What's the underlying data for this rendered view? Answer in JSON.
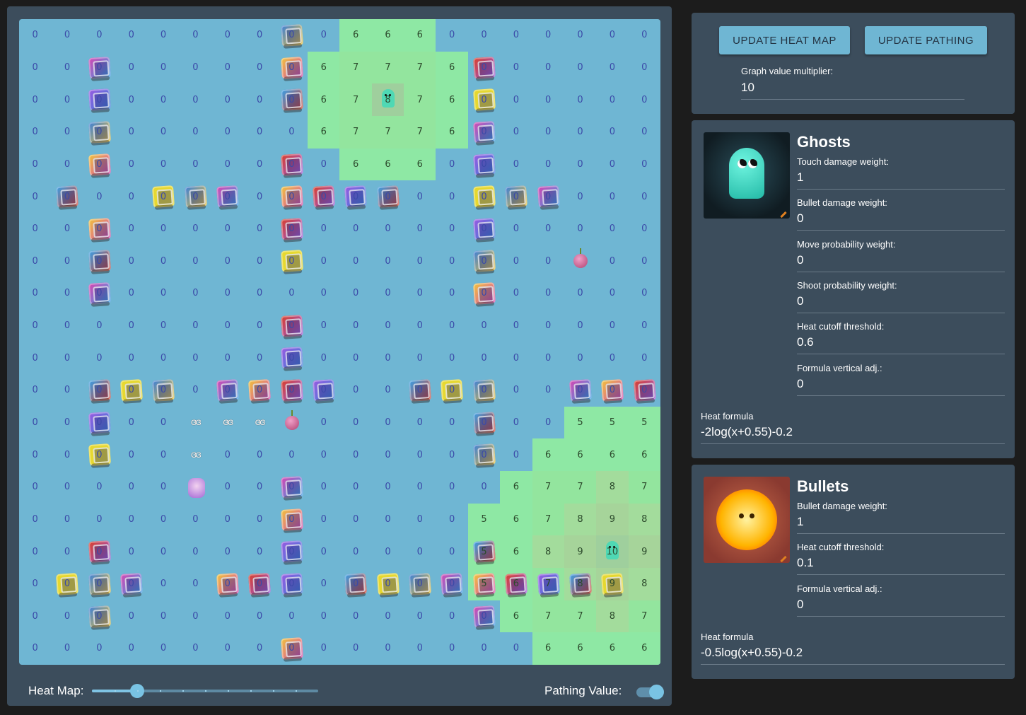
{
  "grid": {
    "rows": [
      [
        "0",
        "0",
        "0",
        "0",
        "0",
        "0",
        "0",
        "0",
        "0",
        "0",
        "6",
        "6",
        "6",
        "0",
        "0",
        "0",
        "0",
        "0",
        "0",
        "0"
      ],
      [
        "0",
        "0",
        "0",
        "0",
        "0",
        "0",
        "0",
        "0",
        "0",
        "6",
        "7",
        "7",
        "7",
        "6",
        "0",
        "0",
        "0",
        "0",
        "0",
        "0"
      ],
      [
        "0",
        "0",
        "0",
        "0",
        "0",
        "0",
        "0",
        "0",
        "0",
        "6",
        "7",
        "8",
        "7",
        "6",
        "0",
        "0",
        "0",
        "0",
        "0",
        "0"
      ],
      [
        "0",
        "0",
        "0",
        "0",
        "0",
        "0",
        "0",
        "0",
        "0",
        "6",
        "7",
        "7",
        "7",
        "6",
        "0",
        "0",
        "0",
        "0",
        "0",
        "0"
      ],
      [
        "0",
        "0",
        "0",
        "0",
        "0",
        "0",
        "0",
        "0",
        "0",
        "0",
        "6",
        "6",
        "6",
        "0",
        "0",
        "0",
        "0",
        "0",
        "0",
        "0"
      ],
      [
        "0",
        "0",
        "0",
        "0",
        "0",
        "0",
        "0",
        "0",
        "0",
        "0",
        "0",
        "0",
        "0",
        "0",
        "0",
        "0",
        "0",
        "0",
        "0",
        "0"
      ],
      [
        "0",
        "0",
        "0",
        "0",
        "0",
        "0",
        "0",
        "0",
        "0",
        "0",
        "0",
        "0",
        "0",
        "0",
        "0",
        "0",
        "0",
        "0",
        "0",
        "0"
      ],
      [
        "0",
        "0",
        "0",
        "0",
        "0",
        "0",
        "0",
        "0",
        "0",
        "0",
        "0",
        "0",
        "0",
        "0",
        "0",
        "0",
        "0",
        "0",
        "0",
        "0"
      ],
      [
        "0",
        "0",
        "0",
        "0",
        "0",
        "0",
        "0",
        "0",
        "0",
        "0",
        "0",
        "0",
        "0",
        "0",
        "0",
        "0",
        "0",
        "0",
        "0",
        "0"
      ],
      [
        "0",
        "0",
        "0",
        "0",
        "0",
        "0",
        "0",
        "0",
        "0",
        "0",
        "0",
        "0",
        "0",
        "0",
        "0",
        "0",
        "0",
        "0",
        "0",
        "0"
      ],
      [
        "0",
        "0",
        "0",
        "0",
        "0",
        "0",
        "0",
        "0",
        "0",
        "0",
        "0",
        "0",
        "0",
        "0",
        "0",
        "0",
        "0",
        "0",
        "0",
        "0"
      ],
      [
        "0",
        "0",
        "0",
        "0",
        "0",
        "0",
        "0",
        "0",
        "0",
        "0",
        "0",
        "0",
        "0",
        "0",
        "0",
        "0",
        "0",
        "0",
        "0",
        "0"
      ],
      [
        "0",
        "0",
        "0",
        "0",
        "0",
        "0",
        "0",
        "0",
        "0",
        "0",
        "0",
        "0",
        "0",
        "0",
        "0",
        "0",
        "0",
        "5",
        "5",
        "5"
      ],
      [
        "0",
        "0",
        "0",
        "0",
        "0",
        "0",
        "0",
        "0",
        "0",
        "0",
        "0",
        "0",
        "0",
        "0",
        "0",
        "0",
        "6",
        "6",
        "6",
        "6"
      ],
      [
        "0",
        "0",
        "0",
        "0",
        "0",
        "0",
        "0",
        "0",
        "0",
        "0",
        "0",
        "0",
        "0",
        "0",
        "0",
        "6",
        "7",
        "7",
        "8",
        "7"
      ],
      [
        "0",
        "0",
        "0",
        "0",
        "0",
        "0",
        "0",
        "0",
        "0",
        "0",
        "0",
        "0",
        "0",
        "0",
        "5",
        "6",
        "7",
        "8",
        "9",
        "8"
      ],
      [
        "0",
        "0",
        "0",
        "0",
        "0",
        "0",
        "0",
        "0",
        "0",
        "0",
        "0",
        "0",
        "0",
        "0",
        "5",
        "6",
        "8",
        "9",
        "10",
        "9"
      ],
      [
        "0",
        "0",
        "0",
        "0",
        "0",
        "0",
        "0",
        "0",
        "0",
        "0",
        "0",
        "0",
        "0",
        "0",
        "5",
        "6",
        "7",
        "8",
        "9",
        "8"
      ],
      [
        "0",
        "0",
        "0",
        "0",
        "0",
        "0",
        "0",
        "0",
        "0",
        "0",
        "0",
        "0",
        "0",
        "0",
        "0",
        "6",
        "7",
        "7",
        "8",
        "7"
      ],
      [
        "0",
        "0",
        "0",
        "0",
        "0",
        "0",
        "0",
        "0",
        "0",
        "0",
        "0",
        "0",
        "0",
        "0",
        "0",
        "0",
        "6",
        "6",
        "6",
        "6"
      ]
    ],
    "walls": [
      [
        0,
        8
      ],
      [
        1,
        2
      ],
      [
        1,
        8
      ],
      [
        1,
        14
      ],
      [
        2,
        2
      ],
      [
        2,
        8
      ],
      [
        2,
        14
      ],
      [
        3,
        2
      ],
      [
        3,
        14
      ],
      [
        4,
        2
      ],
      [
        4,
        8
      ],
      [
        4,
        14
      ],
      [
        5,
        1
      ],
      [
        5,
        4
      ],
      [
        5,
        5
      ],
      [
        5,
        6
      ],
      [
        5,
        8
      ],
      [
        5,
        9
      ],
      [
        5,
        10
      ],
      [
        5,
        11
      ],
      [
        5,
        14
      ],
      [
        5,
        15
      ],
      [
        5,
        16
      ],
      [
        6,
        2
      ],
      [
        6,
        8
      ],
      [
        6,
        14
      ],
      [
        7,
        2
      ],
      [
        7,
        8
      ],
      [
        7,
        14
      ],
      [
        8,
        2
      ],
      [
        8,
        14
      ],
      [
        9,
        8
      ],
      [
        10,
        8
      ],
      [
        11,
        2
      ],
      [
        11,
        3
      ],
      [
        11,
        4
      ],
      [
        11,
        6
      ],
      [
        11,
        7
      ],
      [
        11,
        8
      ],
      [
        11,
        9
      ],
      [
        11,
        12
      ],
      [
        11,
        13
      ],
      [
        11,
        14
      ],
      [
        11,
        17
      ],
      [
        11,
        18
      ],
      [
        11,
        19
      ],
      [
        12,
        2
      ],
      [
        12,
        14
      ],
      [
        13,
        2
      ],
      [
        13,
        14
      ],
      [
        14,
        8
      ],
      [
        15,
        8
      ],
      [
        16,
        2
      ],
      [
        16,
        8
      ],
      [
        16,
        14
      ],
      [
        17,
        1
      ],
      [
        17,
        2
      ],
      [
        17,
        3
      ],
      [
        17,
        6
      ],
      [
        17,
        7
      ],
      [
        17,
        8
      ],
      [
        17,
        10
      ],
      [
        17,
        11
      ],
      [
        17,
        12
      ],
      [
        17,
        13
      ],
      [
        17,
        14
      ],
      [
        17,
        15
      ],
      [
        17,
        16
      ],
      [
        17,
        17
      ],
      [
        17,
        18
      ],
      [
        18,
        2
      ],
      [
        18,
        14
      ],
      [
        19,
        8
      ]
    ],
    "wall_colors": [
      "#3a7ed8",
      "#d845b0",
      "#f0c43a",
      "#d8402a",
      "#9a5ae0",
      "#36a0e8",
      "#e6d830"
    ],
    "ghosts": [
      [
        2,
        11
      ],
      [
        16,
        18
      ]
    ],
    "onions": [
      [
        7,
        17
      ],
      [
        12,
        8
      ]
    ],
    "player": [
      14,
      5
    ],
    "trail": [
      [
        12,
        5
      ],
      [
        12,
        6
      ],
      [
        12,
        7
      ],
      [
        13,
        5
      ]
    ],
    "trail_glyph": "ɞɞ",
    "heat_colors": {
      "5": "#8ee8a4",
      "6": "#8ee8a4",
      "7": "#93e59e",
      "8": "#a3dc9c",
      "9": "#a6d49a",
      "10": "#a8cfa0"
    }
  },
  "footer": {
    "heat_label": "Heat Map:",
    "heat_slider_fraction": 0.2,
    "heat_slider_steps": 10,
    "path_label": "Pathing Value:",
    "path_toggle_on": true
  },
  "controls": {
    "update_heat_label": "UPDATE HEAT MAP",
    "update_path_label": "UPDATE PATHING",
    "multiplier_label": "Graph value multiplier:",
    "multiplier_value": "10"
  },
  "ghosts_card": {
    "title": "Ghosts",
    "fields": [
      {
        "label": "Touch damage weight:",
        "value": "1"
      },
      {
        "label": "Bullet damage weight:",
        "value": "0"
      },
      {
        "label": "Move probability weight:",
        "value": "0"
      },
      {
        "label": "Shoot probability weight:",
        "value": "0"
      },
      {
        "label": "Heat cutoff threshold:",
        "value": "0.6"
      },
      {
        "label": "Formula vertical adj.:",
        "value": "0"
      }
    ],
    "formula_label": "Heat formula",
    "formula_value": "-2log(x+0.55)-0.2"
  },
  "bullets_card": {
    "title": "Bullets",
    "fields": [
      {
        "label": "Bullet damage weight:",
        "value": "1"
      },
      {
        "label": "Heat cutoff threshold:",
        "value": "0.1"
      },
      {
        "label": "Formula vertical adj.:",
        "value": "0"
      }
    ],
    "formula_label": "Heat formula",
    "formula_value": "-0.5log(x+0.55)-0.2"
  }
}
